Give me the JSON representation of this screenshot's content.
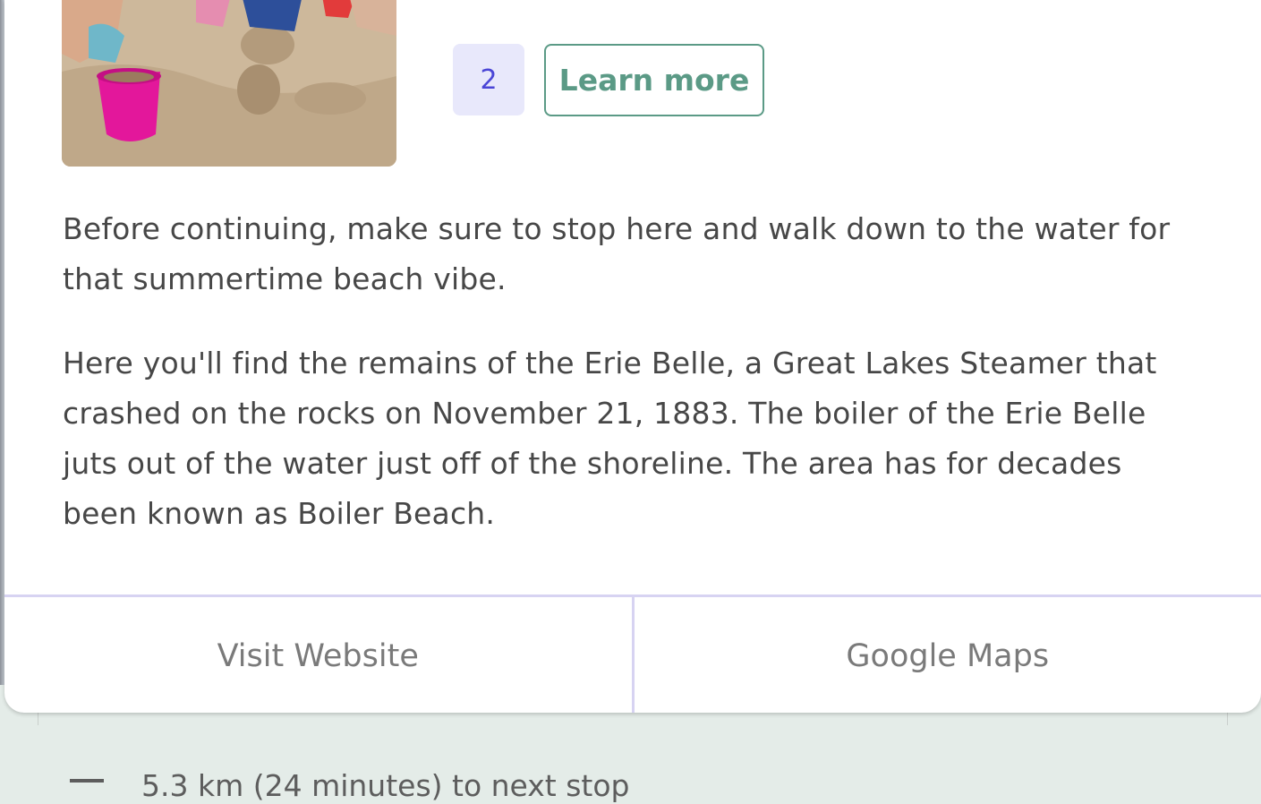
{
  "card": {
    "badge_number": "2",
    "learn_more_label": "Learn more",
    "paragraphs": [
      "Before continuing, make sure to stop here and walk down to the water for that summertime beach vibe.",
      "Here you'll find the remains of the Erie Belle, a Great Lakes Steamer that crashed on the rocks on November 21, 1883.  The boiler of the Erie Belle juts out of the water just off of the shoreline.  The area has for decades been known as Boiler Beach."
    ],
    "footer": {
      "visit_website_label": "Visit Website",
      "google_maps_label": "Google Maps"
    }
  },
  "next_item": {
    "text": "5.3 km (24 minutes) to next stop"
  },
  "colors": {
    "accent_green": "#5b9a86",
    "badge_bg": "#e8e8fb",
    "badge_text": "#4a45d6",
    "divider": "#d7d3f2",
    "page_bg": "#e4ece8"
  }
}
